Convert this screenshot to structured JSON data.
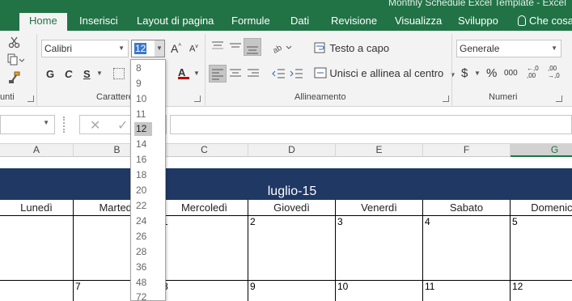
{
  "title_bar": {
    "text": "Monthly Schedule Excel Template - Excel"
  },
  "tabs": [
    {
      "label": "Home"
    },
    {
      "label": "Inserisci"
    },
    {
      "label": "Layout di pagina"
    },
    {
      "label": "Formule"
    },
    {
      "label": "Dati"
    },
    {
      "label": "Revisione"
    },
    {
      "label": "Visualizza"
    },
    {
      "label": "Sviluppo"
    },
    {
      "label": "Che cosa"
    }
  ],
  "ribbon": {
    "clipboard_label": "unti",
    "font_label": "Carattere",
    "alignment_label": "Allineamento",
    "number_label": "Numeri",
    "font_name": "Calibri",
    "font_size": "12",
    "bold": "G",
    "italic": "C",
    "underline": "S",
    "grow_font": "A",
    "shrink_font": "A",
    "font_color": "A",
    "wrap_text": "Testo a capo",
    "merge_center": "Unisci e allinea al centro",
    "number_format": "Generale",
    "currency": "$",
    "percent": "%",
    "thousands": "000",
    "increase_decimal": "←,0 ,00",
    "decrease_decimal": ",00 →,0"
  },
  "colors": {
    "excel_green": "#217346",
    "month_band": "#1f3864"
  },
  "font_size_options": [
    "8",
    "9",
    "10",
    "11",
    "12",
    "14",
    "16",
    "18",
    "20",
    "22",
    "24",
    "26",
    "28",
    "36",
    "48",
    "72"
  ],
  "font_size_selected": "12",
  "columns": [
    "A",
    "B",
    "C",
    "D",
    "E",
    "F",
    "G"
  ],
  "sheet": {
    "month": "luglio-15",
    "days": [
      "Lunedì",
      "Martedì",
      "Mercoledì",
      "Giovedì",
      "Venerdì",
      "Sabato",
      "Domenica"
    ],
    "week1": [
      "",
      "",
      "1",
      "2",
      "3",
      "4",
      "5"
    ],
    "week2": [
      "",
      "7",
      "8",
      "9",
      "10",
      "11",
      "12"
    ]
  }
}
